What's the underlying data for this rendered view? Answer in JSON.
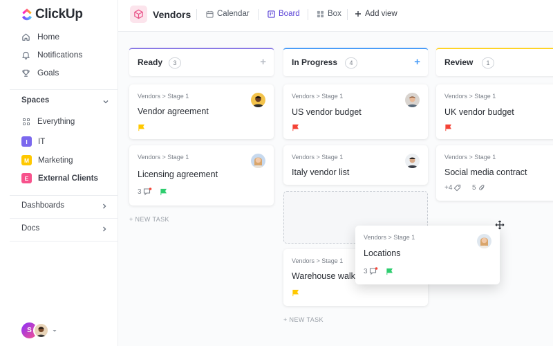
{
  "app": {
    "name": "ClickUp"
  },
  "sidebar": {
    "nav": [
      {
        "label": "Home",
        "icon": "home-icon"
      },
      {
        "label": "Notifications",
        "icon": "bell-icon"
      },
      {
        "label": "Goals",
        "icon": "trophy-icon"
      }
    ],
    "spaces_title": "Spaces",
    "spaces": [
      {
        "label": "Everything",
        "icon": "grid-icon"
      },
      {
        "label": "IT",
        "badge": "I",
        "color": "#7b68ee"
      },
      {
        "label": "Marketing",
        "badge": "M",
        "color": "#ffc800"
      },
      {
        "label": "External Clients",
        "badge": "E",
        "color": "#f7528c"
      }
    ],
    "dashboards": "Dashboards",
    "docs": "Docs",
    "user": {
      "initial": "S"
    }
  },
  "header": {
    "title": "Vendors",
    "views": [
      {
        "label": "Calendar",
        "icon": "calendar-icon"
      },
      {
        "label": "Board",
        "icon": "board-icon",
        "active": true
      },
      {
        "label": "Box",
        "icon": "box-icon"
      },
      {
        "label": "Add view",
        "icon": "plus-icon"
      }
    ]
  },
  "board": {
    "columns": [
      {
        "title": "Ready",
        "count": "3",
        "color": "#8a7ae6",
        "cards": [
          {
            "crumb": "Vendors > Stage 1",
            "title": "Vendor agreement",
            "flag": "#ffc800"
          },
          {
            "crumb": "Vendors > Stage 1",
            "title": "Licensing agreement",
            "comments": "3",
            "flag": "#2ecd6f"
          }
        ],
        "new_task": "+ NEW TASK"
      },
      {
        "title": "In Progress",
        "count": "4",
        "color": "#4a9df8",
        "cards": [
          {
            "crumb": "Vendors > Stage 1",
            "title": "US vendor budget",
            "flag": "#f44336"
          },
          {
            "crumb": "Vendors > Stage 1",
            "title": "Italy vendor list"
          },
          {
            "crumb": "Vendors > Stage 1",
            "title": "Warehouse walk",
            "flag": "#ffc800"
          }
        ],
        "new_task": "+ NEW TASK"
      },
      {
        "title": "Review",
        "count": "1",
        "color": "#ffd426",
        "cards": [
          {
            "crumb": "Vendors > Stage 1",
            "title": "UK vendor budget",
            "flag": "#f44336"
          },
          {
            "crumb": "Vendors > Stage 1",
            "title": "Social media contract",
            "tags": "+4",
            "attachments": "5"
          }
        ]
      }
    ],
    "dragging_card": {
      "crumb": "Vendors > Stage 1",
      "title": "Locations",
      "comments": "3",
      "flag": "#2ecd6f"
    }
  }
}
